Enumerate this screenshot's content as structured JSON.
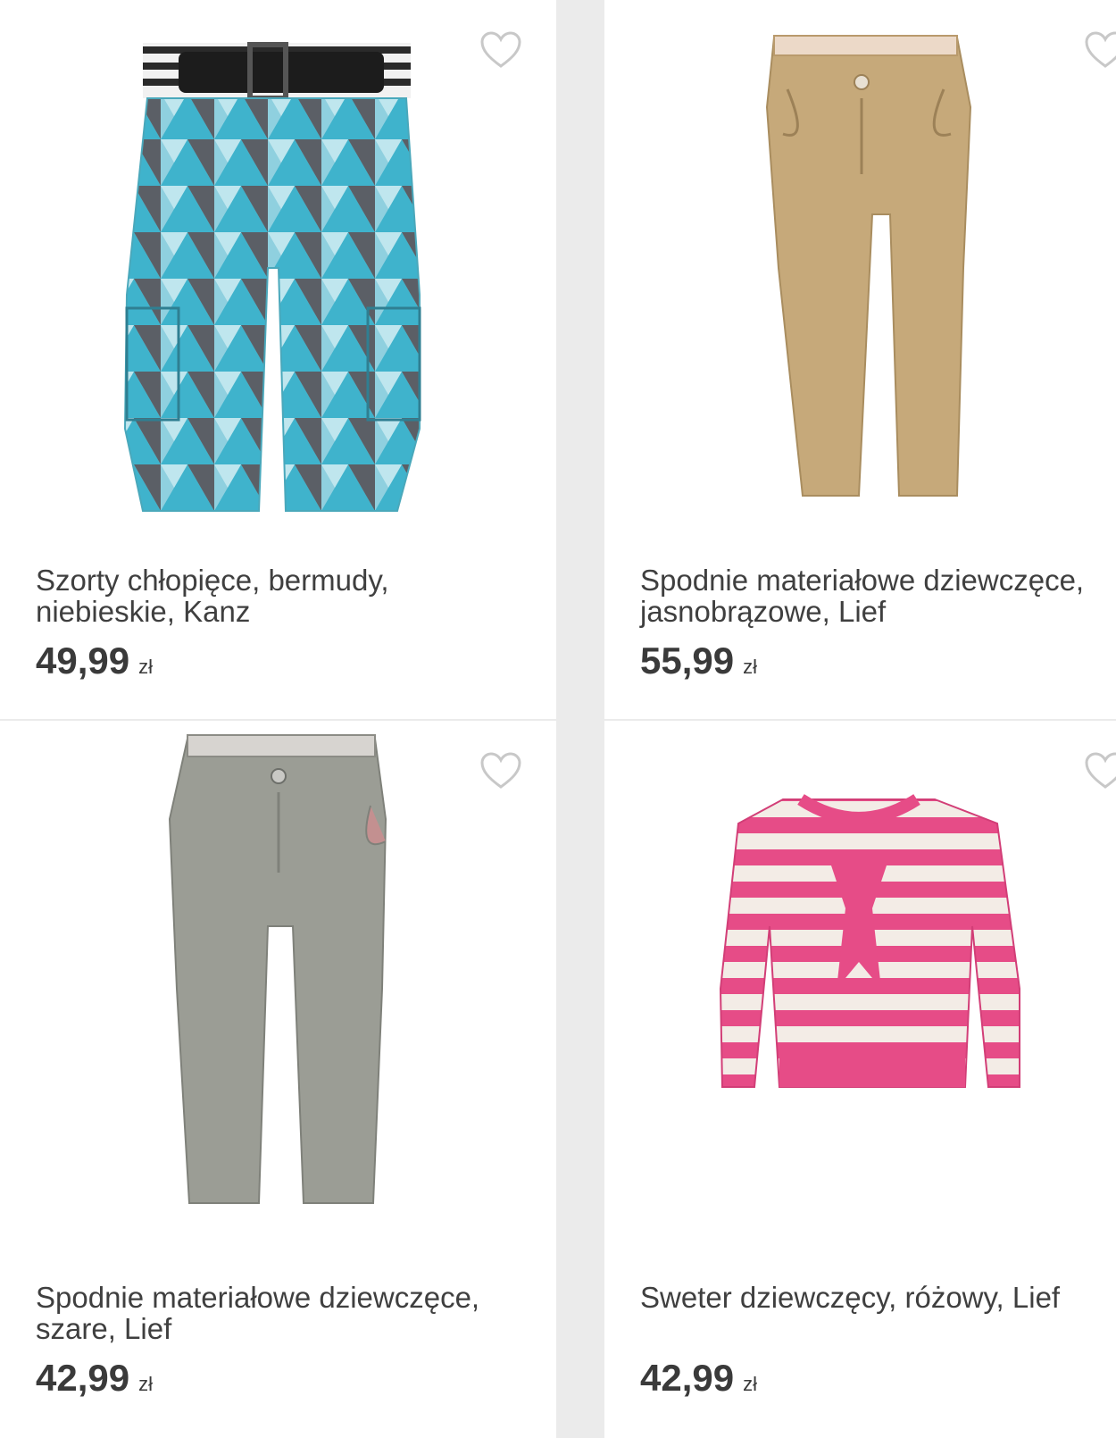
{
  "currency": "zł",
  "products": [
    {
      "title": "Szorty chłopięce, bermudy, niebieskie, Kanz",
      "price": "49,99",
      "image": "blue-camo-shorts"
    },
    {
      "title": "Spodnie materiałowe dziewczęce, jasnobrązowe, Lief",
      "price": "55,99",
      "image": "beige-trousers"
    },
    {
      "title": "Spodnie materiałowe dziewczęce, szare, Lief",
      "price": "42,99",
      "image": "grey-trousers"
    },
    {
      "title": "Sweter dziewczęcy, różowy, Lief",
      "price": "42,99",
      "image": "pink-striped-sweater"
    }
  ]
}
